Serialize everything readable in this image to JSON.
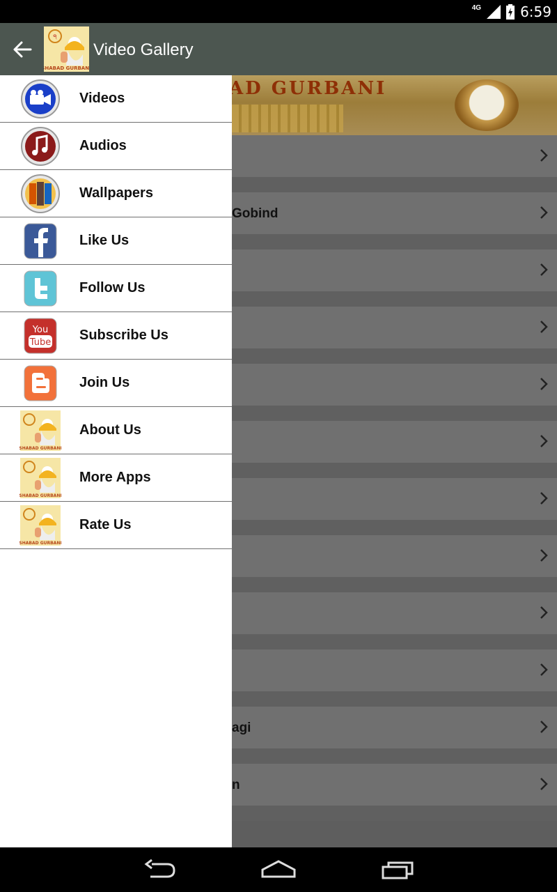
{
  "status": {
    "network": "4G",
    "time": "6:59"
  },
  "appbar": {
    "title": "Video Gallery",
    "logo_text": "SHABAD GURBANI"
  },
  "banner": {
    "text": "AD GURBANI"
  },
  "drawer": {
    "items": [
      {
        "label": "Videos",
        "icon": "video-camera-icon"
      },
      {
        "label": "Audios",
        "icon": "music-note-icon"
      },
      {
        "label": "Wallpapers",
        "icon": "wallpaper-icon"
      },
      {
        "label": "Like Us",
        "icon": "facebook-icon"
      },
      {
        "label": "Follow Us",
        "icon": "twitter-icon"
      },
      {
        "label": "Subscribe Us",
        "icon": "youtube-icon"
      },
      {
        "label": "Join Us",
        "icon": "blogger-icon"
      },
      {
        "label": "About Us",
        "icon": "app-logo-icon"
      },
      {
        "label": "More Apps",
        "icon": "app-logo-icon"
      },
      {
        "label": "Rate Us",
        "icon": "app-logo-icon"
      }
    ]
  },
  "list_partial": [
    "",
    "Gobind",
    "",
    "",
    "",
    "",
    "",
    "",
    "",
    "",
    "agi",
    "n"
  ],
  "colors": {
    "appbar": "#4c5650",
    "drawer": "#ffffff",
    "scrim_content": "#707070"
  }
}
